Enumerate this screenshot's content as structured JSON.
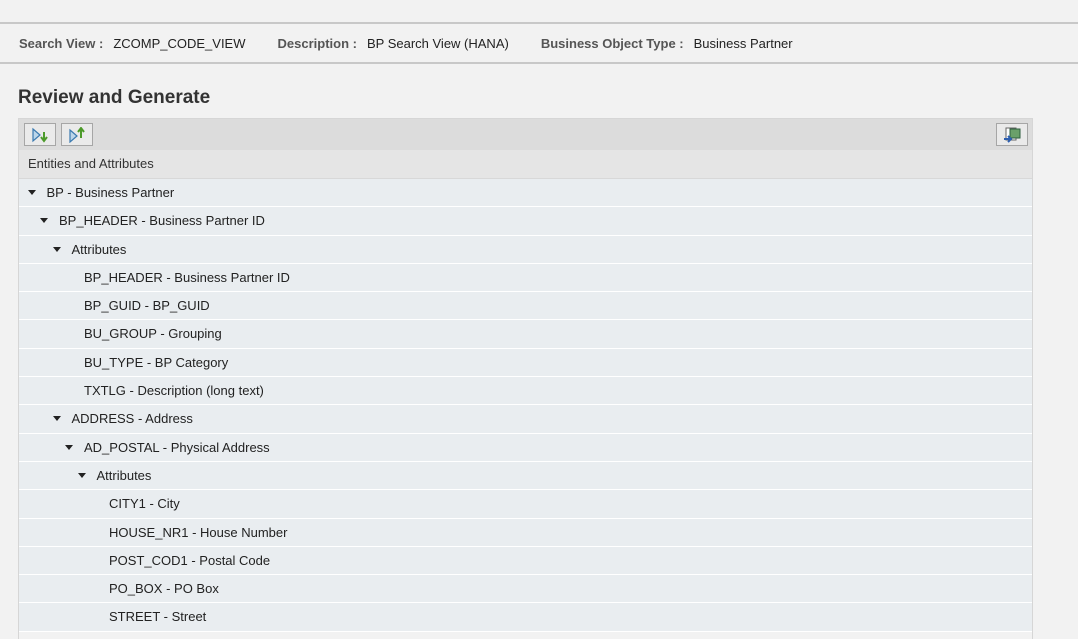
{
  "header": {
    "search_view_label": "Search View :",
    "search_view": "ZCOMP_CODE_VIEW",
    "description_label": "Description :",
    "description": "BP Search View (HANA)",
    "bo_type_label": "Business Object Type :",
    "bo_type": "Business Partner"
  },
  "page_title": "Review and Generate",
  "table": {
    "column_header": "Entities and Attributes",
    "rows": [
      {
        "label": "BP - Business Partner",
        "level": 0,
        "expanded": true
      },
      {
        "label": "BP_HEADER - Business Partner ID",
        "level": 1,
        "expanded": true
      },
      {
        "label": "Attributes",
        "level": 2,
        "expanded": true
      },
      {
        "label": "BP_HEADER - Business Partner ID",
        "level": 3,
        "leaf": true
      },
      {
        "label": "BP_GUID - BP_GUID",
        "level": 3,
        "leaf": true
      },
      {
        "label": "BU_GROUP - Grouping",
        "level": 3,
        "leaf": true
      },
      {
        "label": "BU_TYPE - BP Category",
        "level": 3,
        "leaf": true
      },
      {
        "label": "TXTLG - Description (long text)",
        "level": 3,
        "leaf": true
      },
      {
        "label": "ADDRESS - Address",
        "level": 2,
        "expanded": true
      },
      {
        "label": "AD_POSTAL - Physical Address",
        "level": 3,
        "expanded": true
      },
      {
        "label": "Attributes",
        "level": 4,
        "expanded": true
      },
      {
        "label": "CITY1 - City",
        "level": 5,
        "leaf": true
      },
      {
        "label": "HOUSE_NR1 - House Number",
        "level": 5,
        "leaf": true
      },
      {
        "label": "POST_COD1 - Postal Code",
        "level": 5,
        "leaf": true
      },
      {
        "label": "PO_BOX - PO Box",
        "level": 5,
        "leaf": true
      },
      {
        "label": "STREET - Street",
        "level": 5,
        "leaf": true
      }
    ]
  }
}
